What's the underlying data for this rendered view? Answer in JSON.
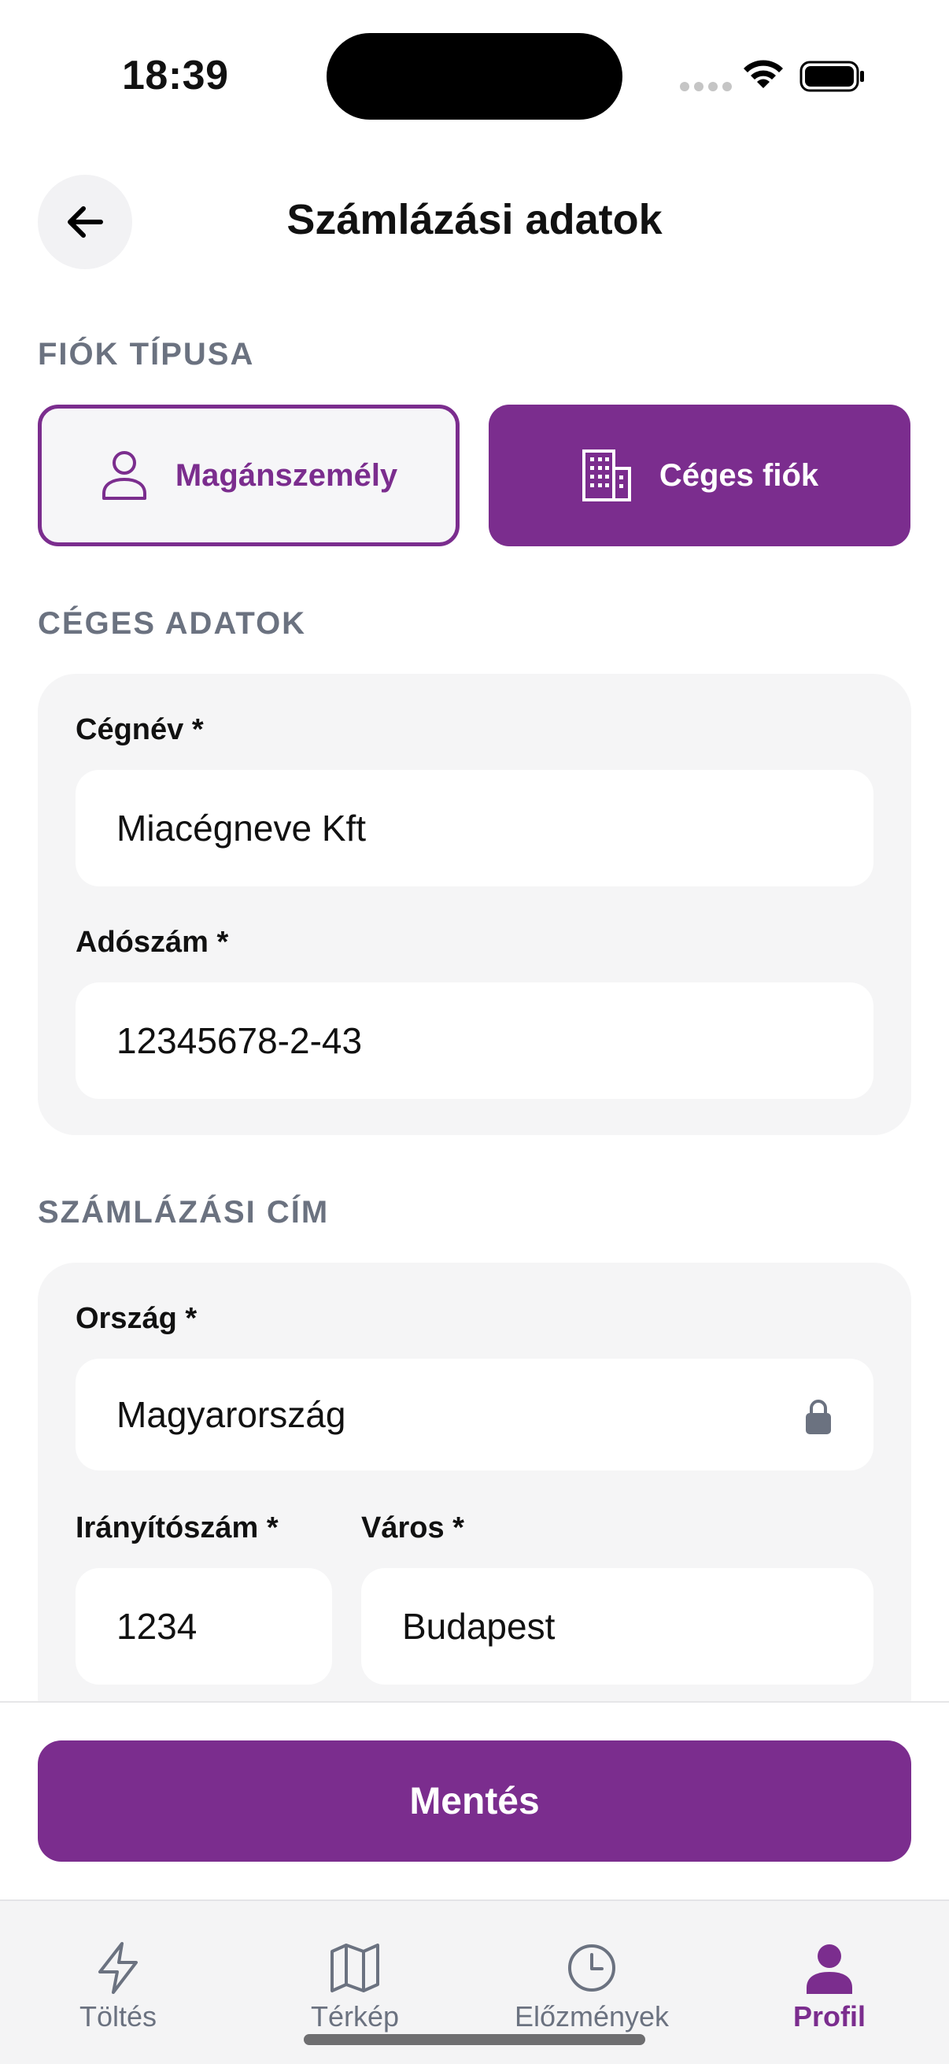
{
  "status_bar": {
    "time": "18:39"
  },
  "header": {
    "title": "Számlázási adatok"
  },
  "account_type": {
    "section_label": "FIÓK TÍPUSA",
    "options": [
      {
        "label": "Magánszemély",
        "icon": "person-icon",
        "selected": false
      },
      {
        "label": "Céges fiók",
        "icon": "building-icon",
        "selected": true
      }
    ]
  },
  "company": {
    "section_label": "CÉGES ADATOK",
    "name_label": "Cégnév *",
    "name_value": "Miacégneve Kft",
    "tax_label": "Adószám *",
    "tax_value": "12345678-2-43"
  },
  "billing_address": {
    "section_label": "SZÁMLÁZÁSI CÍM",
    "country_label": "Ország *",
    "country_value": "Magyarország",
    "zip_label": "Irányítószám *",
    "zip_value": "1234",
    "city_label": "Város *",
    "city_value": "Budapest"
  },
  "actions": {
    "save_label": "Mentés"
  },
  "tabbar": {
    "tabs": [
      {
        "label": "Töltés",
        "icon": "bolt-icon",
        "active": false
      },
      {
        "label": "Térkép",
        "icon": "map-icon",
        "active": false
      },
      {
        "label": "Előzmények",
        "icon": "clock-icon",
        "active": false
      },
      {
        "label": "Profil",
        "icon": "person-filled-icon",
        "active": true
      }
    ]
  },
  "colors": {
    "accent": "#7b2d8e",
    "muted": "#6b7280",
    "card_bg": "#f5f5f6"
  }
}
